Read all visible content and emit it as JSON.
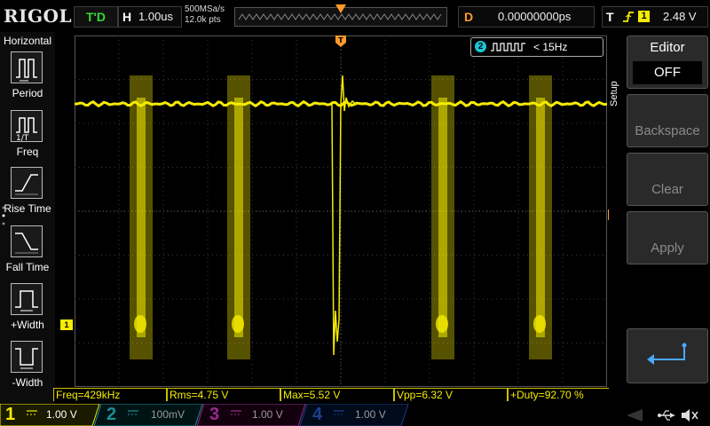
{
  "header": {
    "brand": "RIGOL",
    "run_status": "T'D",
    "timebase_label": "H",
    "timebase_value": "1.00us",
    "sample_rate": "500MSa/s",
    "memory_depth": "12.0k pts",
    "offset_label": "D",
    "offset_value": "0.00000000ps",
    "trigger_type": "T",
    "trigger_source": "1",
    "trigger_level": "2.48 V"
  },
  "left_menu": {
    "title": "Horizontal",
    "items": [
      {
        "label": "Period",
        "icon": "period-icon"
      },
      {
        "label": "Freq",
        "icon": "freq-icon"
      },
      {
        "label": "Rise Time",
        "icon": "rise-time-icon"
      },
      {
        "label": "Fall Time",
        "icon": "fall-time-icon"
      },
      {
        "label": "+Width",
        "icon": "positive-width-icon"
      },
      {
        "label": "-Width",
        "icon": "negative-width-icon"
      }
    ]
  },
  "plot": {
    "ch1_marker": "1",
    "trigger_marker": "T",
    "freq_counter": {
      "channel": "2",
      "value": "< 15Hz"
    }
  },
  "measurements": [
    "Freq=429kHz",
    "Rms=4.75 V",
    "Max=5.52 V",
    "Vpp=6.32 V",
    "+Duty=92.70 %"
  ],
  "right_menu": {
    "side_label": "Setup",
    "editor_title": "Editor",
    "editor_value": "OFF",
    "backspace": "Backspace",
    "clear": "Clear",
    "apply": "Apply"
  },
  "channels": [
    {
      "num": "1",
      "scale": "1.00 V",
      "color": "#f5ec00"
    },
    {
      "num": "2",
      "scale": "100mV",
      "color": "#1a8e96"
    },
    {
      "num": "3",
      "scale": "1.00 V",
      "color": "#9a2a8e"
    },
    {
      "num": "4",
      "scale": "1.00 V",
      "color": "#1c3f8a"
    }
  ],
  "colors": {
    "ch1": "#f5ec00",
    "ch2": "#1ac6d6",
    "trigger": "#ff9a2b",
    "run": "#33dd33"
  }
}
